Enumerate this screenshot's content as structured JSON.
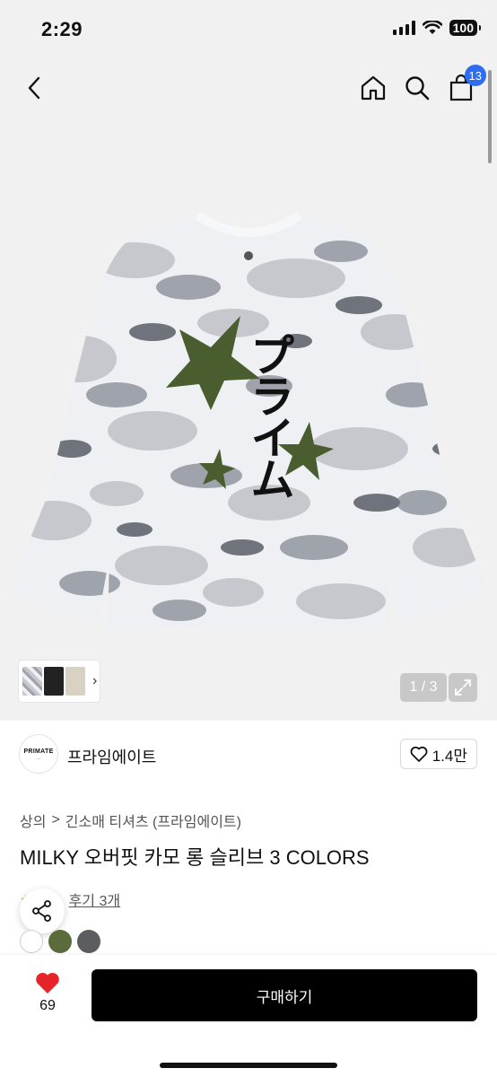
{
  "status": {
    "time": "2:29",
    "battery": "100"
  },
  "nav": {
    "cart_count": "13"
  },
  "gallery": {
    "counter": "1 / 3",
    "print_text": "プライム"
  },
  "brand": {
    "logo_text": "PRIMATE",
    "name": "프라임에이트",
    "likes": "1.4만"
  },
  "breadcrumb": {
    "items": [
      "상의",
      "긴소매 티셔츠 (프라임에이트)"
    ],
    "separator": ">"
  },
  "product": {
    "title": "MILKY 오버핏 카모 롱 슬리브 3 COLORS",
    "reviews": "후기 3개"
  },
  "swatch_colors": [
    "#ffffff",
    "#5b6b3a",
    "#5b5d60"
  ],
  "bottom": {
    "like_count": "69",
    "buy_label": "구매하기"
  },
  "colors": {
    "accent": "#2c6df2",
    "heart": "#e8242b",
    "buy_bg": "#000000",
    "star_green": "#4a5d2f"
  }
}
